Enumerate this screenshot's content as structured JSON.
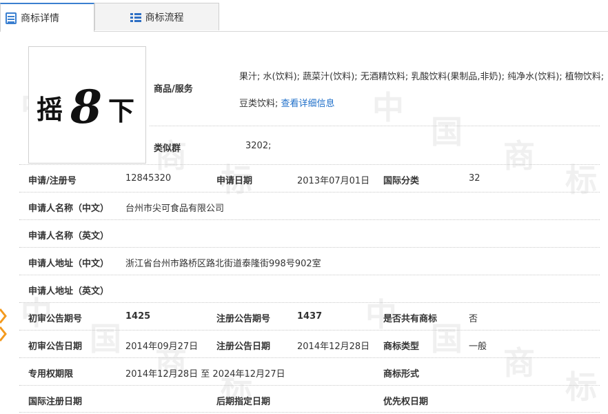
{
  "tabs": {
    "detail": "商标详情",
    "flow": "商标流程"
  },
  "logo": {
    "char1": "摇",
    "char2": "8",
    "char3": "下"
  },
  "goods": {
    "label": "商品/服务",
    "text": "果汁; 水(饮料); 蔬菜汁(饮料); 无酒精饮料; 乳酸饮料(果制品,非奶); 纯净水(饮料); 植物饮料; 豆类饮料;",
    "more_link": "查看详细信息"
  },
  "similar_group": {
    "label": "类似群",
    "value": "3202;"
  },
  "fields": {
    "reg_no_label": "申请/注册号",
    "reg_no": "12845320",
    "apply_date_label": "申请日期",
    "apply_date": "2013年07月01日",
    "intl_class_label": "国际分类",
    "intl_class": "32",
    "applicant_cn_label": "申请人名称（中文）",
    "applicant_cn": "台州市尖可食品有限公司",
    "applicant_en_label": "申请人名称（英文）",
    "address_cn_label": "申请人地址（中文）",
    "address_cn": "浙江省台州市路桥区路北街道泰隆街998号902室",
    "address_en_label": "申请人地址（英文）",
    "prelim_issue_label": "初审公告期号",
    "prelim_issue": "1425",
    "reg_issue_label": "注册公告期号",
    "reg_issue": "1437",
    "shared_label": "是否共有商标",
    "shared": "否",
    "prelim_date_label": "初审公告日期",
    "prelim_date": "2014年09月27日",
    "reg_date_label": "注册公告日期",
    "reg_date": "2014年12月28日",
    "type_label": "商标类型",
    "type": "一般",
    "term_label": "专用权期限",
    "term": "2014年12月28日 至 2024年12月27日",
    "form_label": "商标形式",
    "intl_reg_date_label": "国际注册日期",
    "later_designation_label": "后期指定日期",
    "priority_date_label": "优先权日期"
  },
  "watermark": [
    "中",
    "国",
    "商",
    "标"
  ],
  "colors": {
    "accent": "#3a7fd0",
    "link": "#1f6fc9",
    "side_mark": "#f39a1e"
  }
}
